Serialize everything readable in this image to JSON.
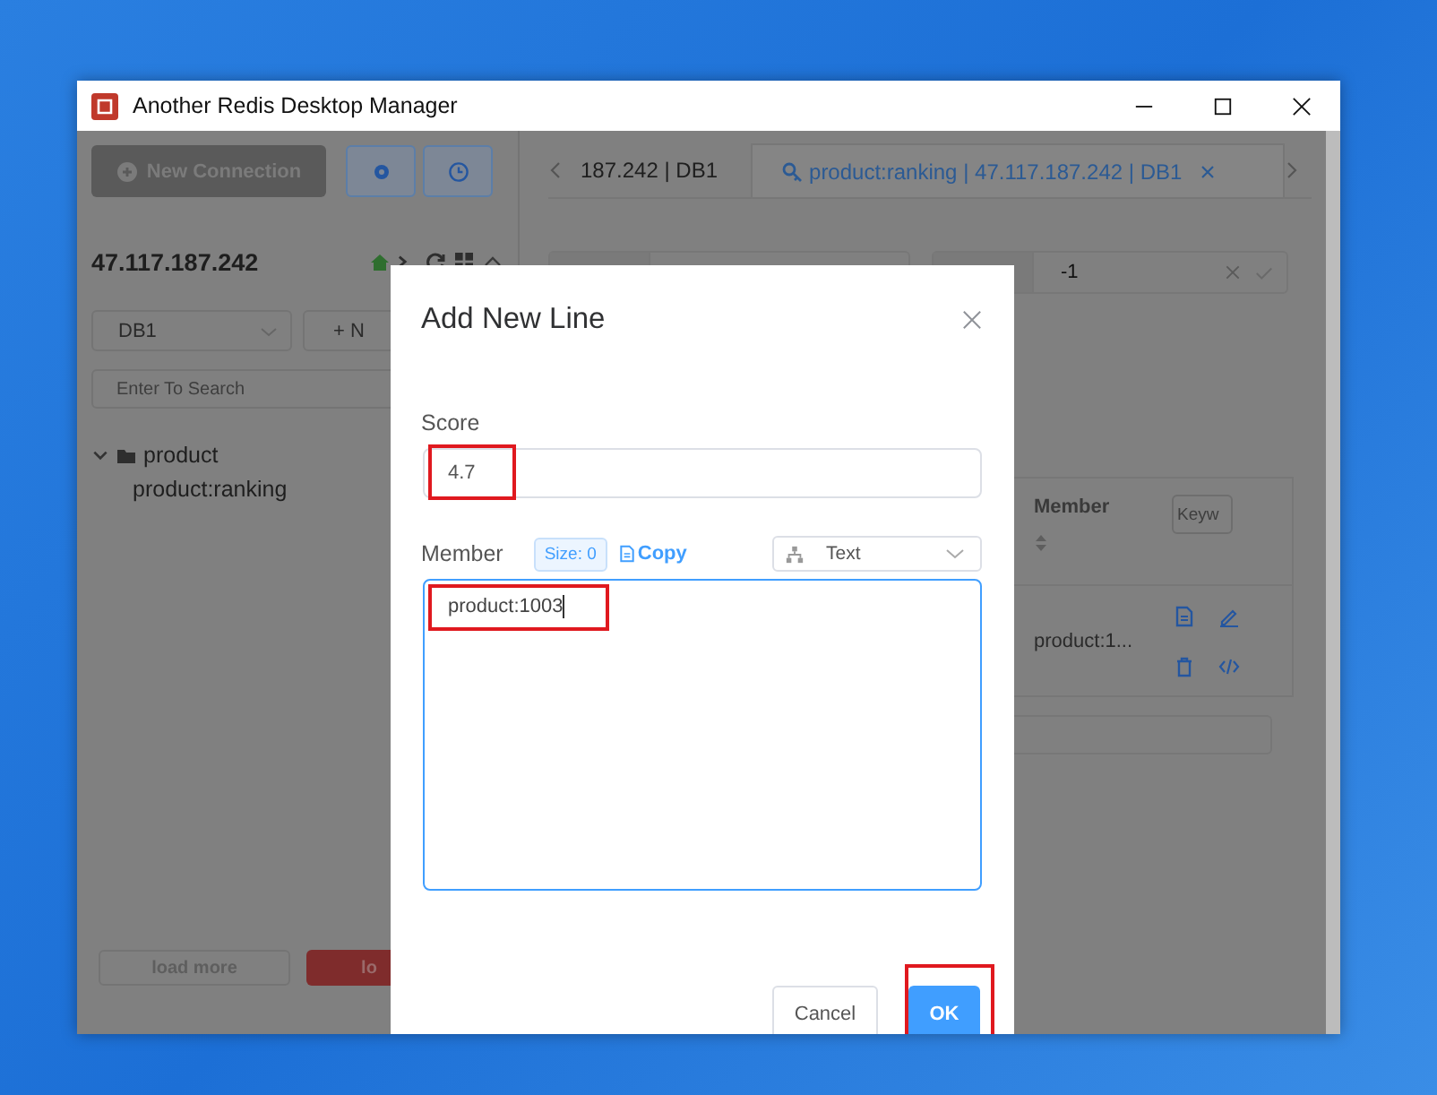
{
  "window": {
    "title": "Another Redis Desktop Manager"
  },
  "sidebar": {
    "new_connection": "New Connection",
    "connection": "47.117.187.242",
    "db_select": "DB1",
    "new_key_button": "+ N",
    "search": {
      "placeholder": "Enter To Search"
    },
    "tree": [
      {
        "label": "product",
        "expanded": true,
        "children": [
          {
            "label": "product:ranking"
          }
        ]
      }
    ],
    "load_more": "load more",
    "load_all": "lo"
  },
  "tabs": [
    {
      "label": "187.242 | DB1",
      "selected": false
    },
    {
      "label": "product:ranking | 47.117.187.242 | DB1",
      "selected": true
    }
  ],
  "ttl_field": {
    "value": "-1"
  },
  "table": {
    "columns": [
      "Member"
    ],
    "search": {
      "placeholder": "Keyw"
    },
    "rows": [
      {
        "member": "product:1..."
      }
    ]
  },
  "dialog": {
    "title": "Add New Line",
    "score": {
      "label": "Score",
      "value": "4.7",
      "highlighted": true
    },
    "member": {
      "label": "Member",
      "size": "Size: 0",
      "copy": "Copy",
      "format": "Text",
      "value": "product:1003",
      "highlighted": true
    },
    "buttons": [
      {
        "label": "Cancel",
        "kind": "default",
        "highlighted": false
      },
      {
        "label": "OK",
        "kind": "primary",
        "highlighted": true
      }
    ]
  }
}
